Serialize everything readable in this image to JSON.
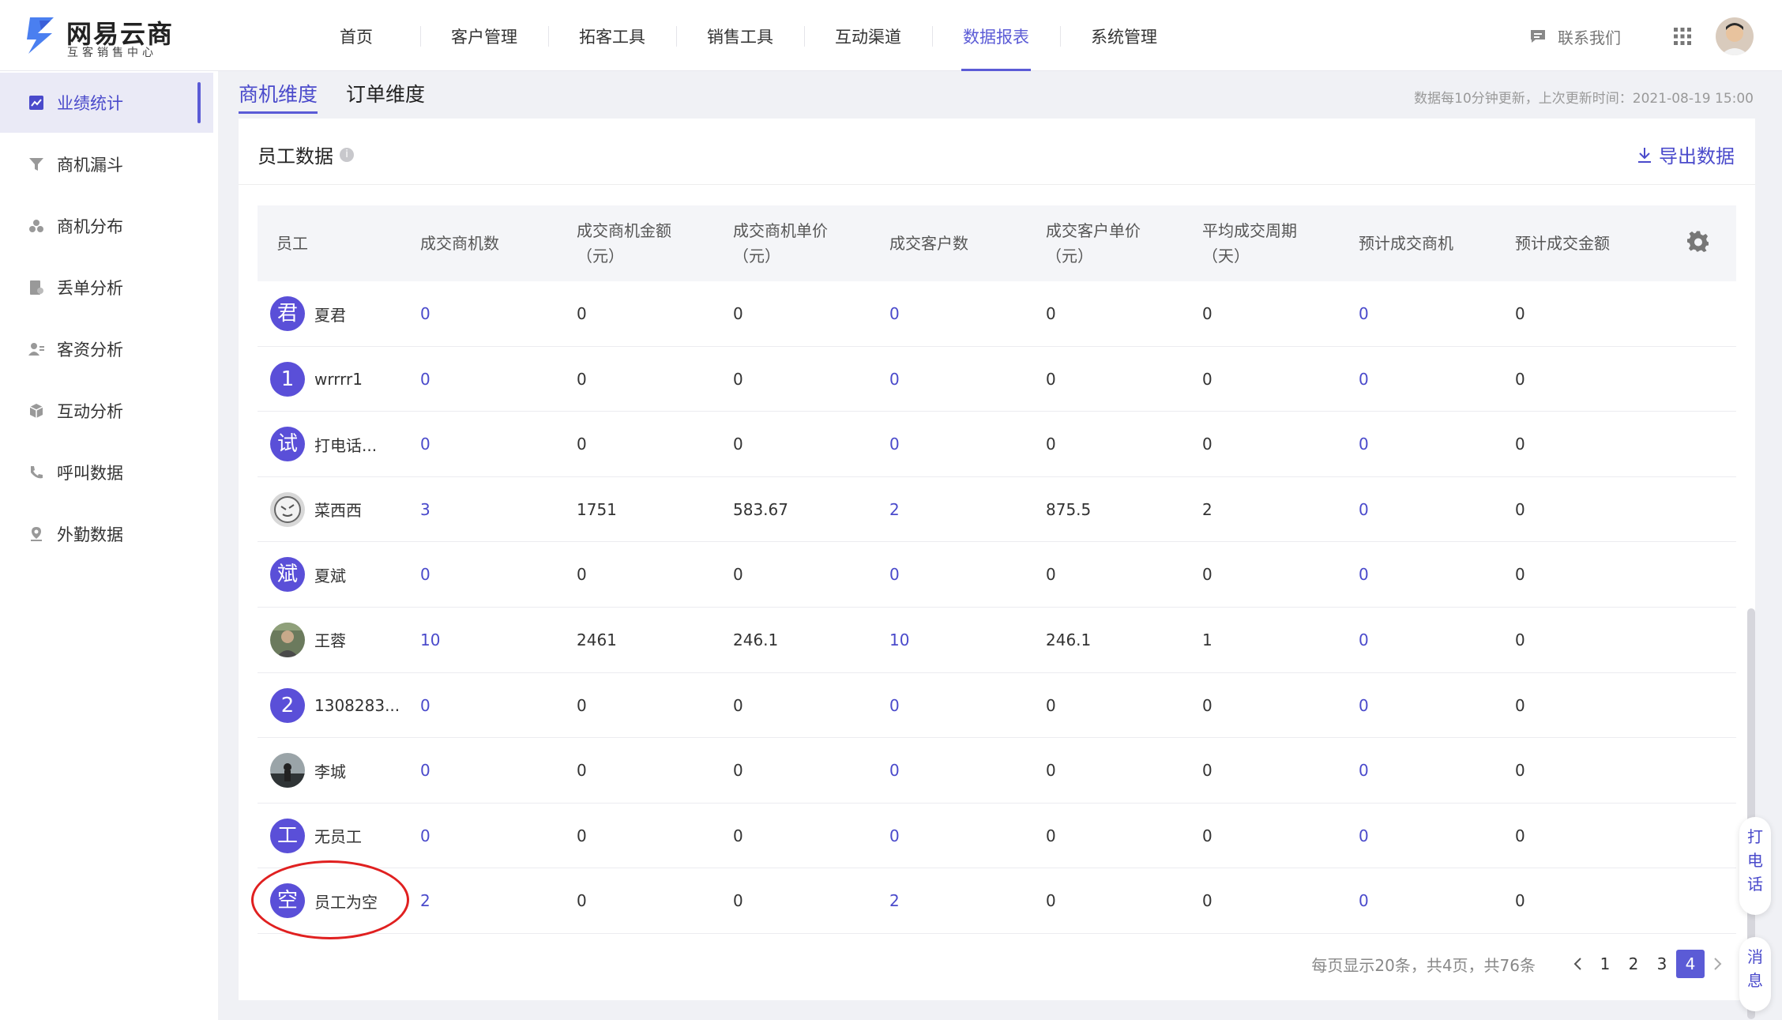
{
  "brand": {
    "title": "网易云商",
    "subtitle": "互客销售中心"
  },
  "nav": {
    "items": [
      "首页",
      "客户管理",
      "拓客工具",
      "销售工具",
      "互动渠道",
      "数据报表",
      "系统管理"
    ],
    "active": "数据报表"
  },
  "header": {
    "contact": "联系我们"
  },
  "sidebar": {
    "items": [
      {
        "label": "业绩统计",
        "icon": "chart-line-icon",
        "active": true
      },
      {
        "label": "商机漏斗",
        "icon": "funnel-icon"
      },
      {
        "label": "商机分布",
        "icon": "distribution-icon"
      },
      {
        "label": "丢单分析",
        "icon": "document-icon"
      },
      {
        "label": "客资分析",
        "icon": "user-card-icon"
      },
      {
        "label": "互动分析",
        "icon": "cube-icon"
      },
      {
        "label": "呼叫数据",
        "icon": "phone-icon"
      },
      {
        "label": "外勤数据",
        "icon": "location-pin-icon"
      }
    ]
  },
  "tabs": [
    "商机维度",
    "订单维度"
  ],
  "update_note": "数据每10分钟更新，上次更新时间：2021-08-19 15:00",
  "card": {
    "title": "员工数据",
    "info": "i",
    "export_label": "导出数据"
  },
  "table": {
    "headers": [
      "员工",
      "成交商机数",
      "成交商机金额\n（元）",
      "成交商机单价\n（元）",
      "成交客户数",
      "成交客户单价\n（元）",
      "平均成交周期\n（天）",
      "预计成交商机",
      "预计成交金额"
    ],
    "rows": [
      {
        "avatar": "君",
        "name": "夏君",
        "cells": [
          "0",
          "0",
          "0",
          "0",
          "0",
          "0",
          "0",
          "0"
        ]
      },
      {
        "avatar": "1",
        "name": "wrrrr1",
        "cells": [
          "0",
          "0",
          "0",
          "0",
          "0",
          "0",
          "0",
          "0"
        ]
      },
      {
        "avatar": "试",
        "name": "打电话...",
        "cells": [
          "0",
          "0",
          "0",
          "0",
          "0",
          "0",
          "0",
          "0"
        ]
      },
      {
        "avatar": "",
        "name": "菜西西",
        "cells": [
          "3",
          "1751",
          "583.67",
          "2",
          "875.5",
          "2",
          "0",
          "0"
        ]
      },
      {
        "avatar": "斌",
        "name": "夏斌",
        "cells": [
          "0",
          "0",
          "0",
          "0",
          "0",
          "0",
          "0",
          "0"
        ]
      },
      {
        "avatar": "",
        "name": "王蓉",
        "cells": [
          "10",
          "2461",
          "246.1",
          "10",
          "246.1",
          "1",
          "0",
          "0"
        ]
      },
      {
        "avatar": "2",
        "name": "1308283...",
        "cells": [
          "0",
          "0",
          "0",
          "0",
          "0",
          "0",
          "0",
          "0"
        ]
      },
      {
        "avatar": "",
        "name": "李城",
        "cells": [
          "0",
          "0",
          "0",
          "0",
          "0",
          "0",
          "0",
          "0"
        ]
      },
      {
        "avatar": "工",
        "name": "无员工",
        "cells": [
          "0",
          "0",
          "0",
          "0",
          "0",
          "0",
          "0",
          "0"
        ]
      },
      {
        "avatar": "空",
        "name": "员工为空",
        "cells": [
          "2",
          "0",
          "0",
          "2",
          "0",
          "0",
          "0",
          "0"
        ]
      }
    ],
    "link_columns": [
      0,
      3,
      6
    ]
  },
  "pager": {
    "summary": "每页显示20条，共4页，共76条",
    "pages": [
      "1",
      "2",
      "3",
      "4"
    ],
    "current": "4"
  },
  "float_buttons": {
    "call": "打\n电\n话",
    "message": "消\n息"
  },
  "colors": {
    "accent": "#5b5bd6",
    "highlight": "#e02020"
  }
}
